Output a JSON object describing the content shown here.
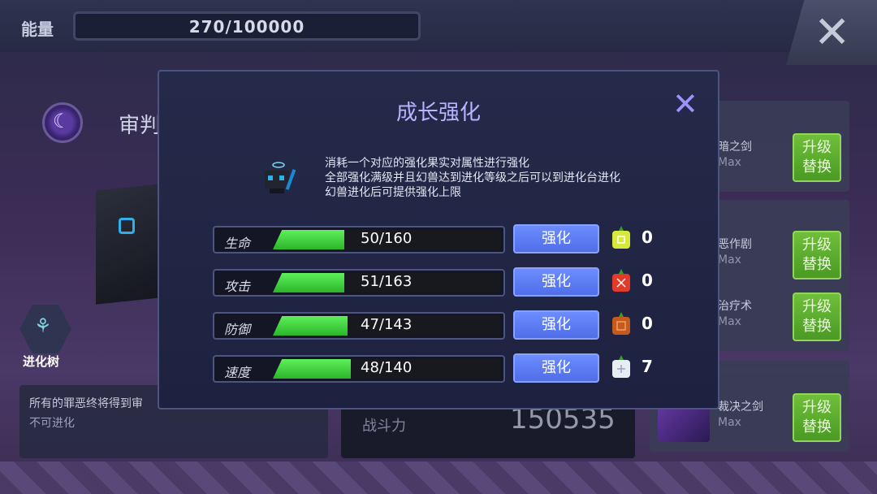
{
  "topbar": {
    "energy_label": "能量",
    "energy_value": "270/100000",
    "close_icon": "close-icon"
  },
  "background": {
    "pet_name": "审判",
    "evolution_tree_label": "进化树",
    "description_line1": "所有的罪恶终将得到审",
    "description_line2": "不可进化",
    "power_label": "战斗力",
    "power_value": "150535",
    "skills": [
      {
        "name": "暗之剑",
        "level": "Max",
        "button": "升级\n替换"
      },
      {
        "name": "恶作剧",
        "level": "Max",
        "button": "升级\n替换"
      },
      {
        "name": "治疗术",
        "level": "Max",
        "button": "升级\n替换"
      },
      {
        "name": "裁决之剑",
        "level": "Max",
        "button": "升级\n替换"
      }
    ]
  },
  "modal": {
    "title": "成长强化",
    "close_icon": "close-x-icon",
    "info_lines": [
      "消耗一个对应的强化果实对属性进行强化",
      "全部强化满级并且幻兽达到进化等级之后可以到进化台进化",
      "幻兽进化后可提供强化上限"
    ],
    "stats": [
      {
        "label": "生命",
        "value": "50/160",
        "fill": 0.3125,
        "button": "强化",
        "fruit_color": "#d6e83a",
        "fruit_icon": "yellow-fruit-icon",
        "count": "0"
      },
      {
        "label": "攻击",
        "value": "51/163",
        "fill": 0.3129,
        "button": "强化",
        "fruit_color": "#e33a2a",
        "fruit_icon": "red-fruit-icon",
        "count": "0"
      },
      {
        "label": "防御",
        "value": "47/143",
        "fill": 0.3287,
        "button": "强化",
        "fruit_color": "#c45a1e",
        "fruit_icon": "orange-fruit-icon",
        "count": "0"
      },
      {
        "label": "速度",
        "value": "48/140",
        "fill": 0.3429,
        "button": "强化",
        "fruit_color": "#e8ecf4",
        "fruit_icon": "white-fruit-icon",
        "count": "7"
      }
    ]
  }
}
